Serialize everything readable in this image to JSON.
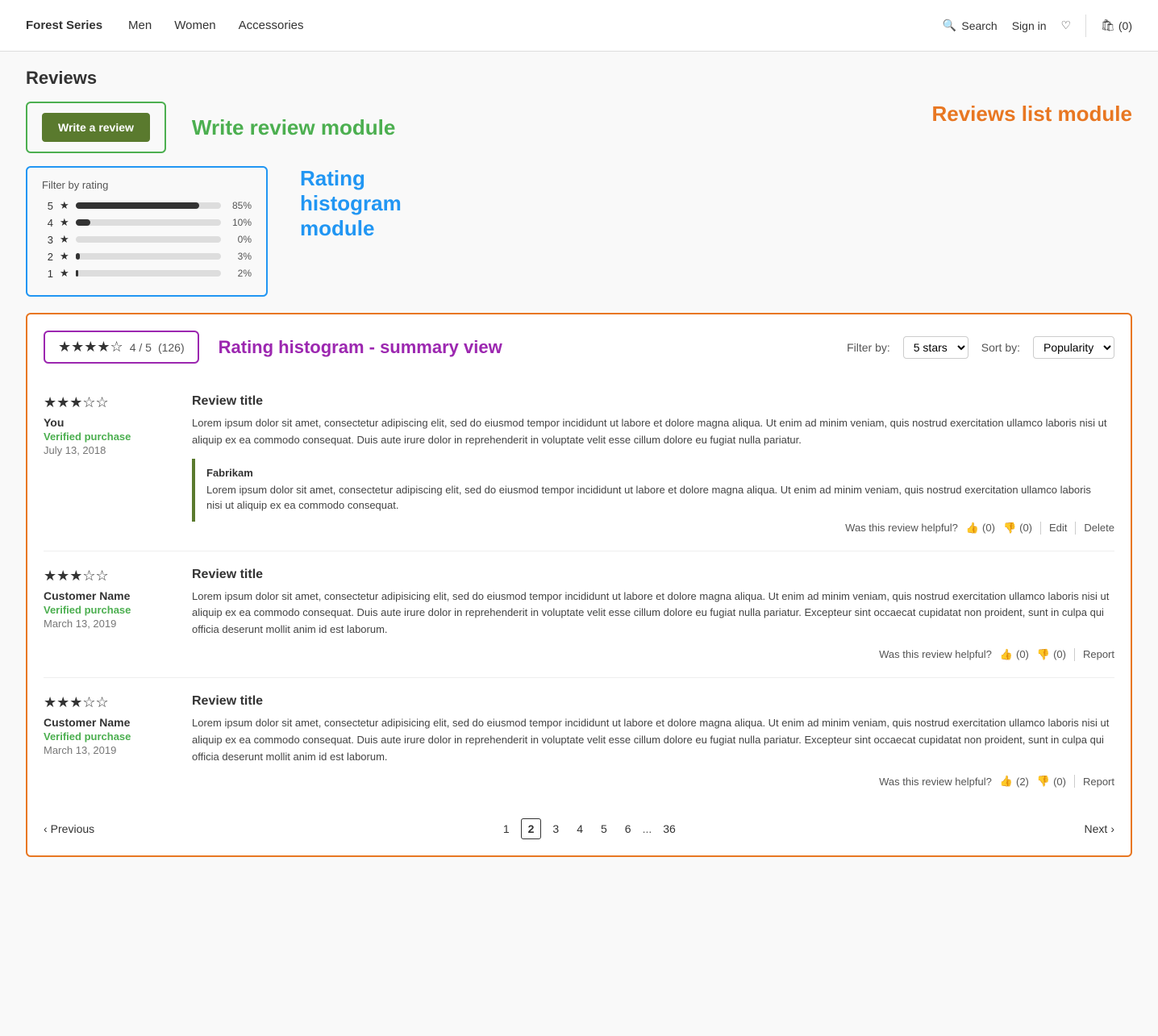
{
  "navbar": {
    "brand": "Forest Series",
    "links": [
      "Men",
      "Women",
      "Accessories"
    ],
    "search_label": "Search",
    "signin_label": "Sign in",
    "cart_label": "(0)"
  },
  "page": {
    "section_title": "Reviews",
    "write_review": {
      "btn_label": "Write a review",
      "module_label": "Write review module"
    },
    "histogram": {
      "filter_label": "Filter by rating",
      "module_label": "Rating histogram module",
      "rows": [
        {
          "stars": 5,
          "pct": 85,
          "pct_label": "85%"
        },
        {
          "stars": 4,
          "pct": 10,
          "pct_label": "10%"
        },
        {
          "stars": 3,
          "pct": 0,
          "pct_label": "0%"
        },
        {
          "stars": 2,
          "pct": 3,
          "pct_label": "3%"
        },
        {
          "stars": 1,
          "pct": 2,
          "pct_label": "2%"
        }
      ]
    },
    "reviews_list": {
      "module_label": "Reviews list module",
      "summary": {
        "stars": "★★★★☆",
        "score": "4 / 5",
        "count": "(126)",
        "label": "Rating histogram - summary view"
      },
      "filter_by_label": "Filter by:",
      "filter_value": "5 stars",
      "sort_by_label": "Sort by:",
      "sort_value": "Popularity",
      "reviews": [
        {
          "stars": "★★★☆☆",
          "reviewer": "You",
          "verified": "Verified purchase",
          "date": "July 13, 2018",
          "title": "Review title",
          "body": "Lorem ipsum dolor sit amet, consectetur adipiscing elit, sed do eiusmod tempor incididunt ut labore et dolore magna aliqua. Ut enim ad minim veniam, quis nostrud exercitation ullamco laboris nisi ut aliquip ex ea commodo consequat. Duis aute irure dolor in reprehenderit in voluptate velit esse cillum dolore eu fugiat nulla pariatur.",
          "helpful_label": "Was this review helpful?",
          "thumbs_up": "(0)",
          "thumbs_down": "(0)",
          "actions": [
            "Edit",
            "Delete"
          ],
          "reply": {
            "brand": "Fabrikam",
            "body": "Lorem ipsum dolor sit amet, consectetur adipiscing elit, sed do eiusmod tempor incididunt ut labore et dolore magna aliqua. Ut enim ad minim veniam, quis nostrud exercitation ullamco laboris nisi ut aliquip ex ea commodo consequat."
          }
        },
        {
          "stars": "★★★☆☆",
          "reviewer": "Customer Name",
          "verified": "Verified purchase",
          "date": "March 13, 2019",
          "title": "Review title",
          "body": "Lorem ipsum dolor sit amet, consectetur adipisicing elit, sed do eiusmod tempor incididunt ut labore et dolore magna aliqua. Ut enim ad minim veniam, quis nostrud exercitation ullamco laboris nisi ut aliquip ex ea commodo consequat. Duis aute irure dolor in reprehenderit in voluptate velit esse cillum dolore eu fugiat nulla pariatur. Excepteur sint occaecat cupidatat non proident, sunt in culpa qui officia deserunt mollit anim id est laborum.",
          "helpful_label": "Was this review helpful?",
          "thumbs_up": "(0)",
          "thumbs_down": "(0)",
          "actions": [
            "Report"
          ],
          "reply": null
        },
        {
          "stars": "★★★☆☆",
          "reviewer": "Customer Name",
          "verified": "Verified purchase",
          "date": "March 13, 2019",
          "title": "Review title",
          "body": "Lorem ipsum dolor sit amet, consectetur adipisicing elit, sed do eiusmod tempor incididunt ut labore et dolore magna aliqua. Ut enim ad minim veniam, quis nostrud exercitation ullamco laboris nisi ut aliquip ex ea commodo consequat. Duis aute irure dolor in reprehenderit in voluptate velit esse cillum dolore eu fugiat nulla pariatur. Excepteur sint occaecat cupidatat non proident, sunt in culpa qui officia deserunt mollit anim id est laborum.",
          "helpful_label": "Was this review helpful?",
          "thumbs_up": "(2)",
          "thumbs_down": "(0)",
          "actions": [
            "Report"
          ],
          "reply": null
        }
      ],
      "pagination": {
        "prev_label": "Previous",
        "next_label": "Next",
        "pages": [
          "1",
          "2",
          "3",
          "4",
          "5",
          "6",
          "...",
          "36"
        ],
        "active_page": "2"
      }
    }
  }
}
